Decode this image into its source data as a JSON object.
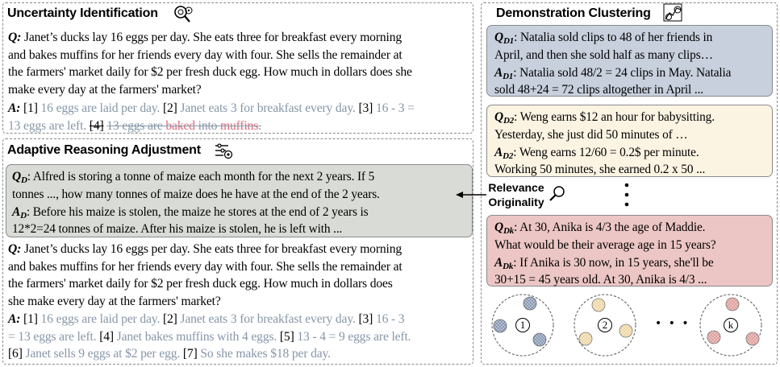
{
  "uncertainty": {
    "title": "Uncertainty Identification",
    "q_label": "Q:",
    "question_lines": [
      "Janet’s ducks lay 16 eggs per day. She eats three for breakfast every morning",
      "and bakes muffins for her friends every day with four. She sells the remainder at",
      "the farmers' market daily for $2 per fresh duck egg. How much in dollars does she",
      "make every day at the farmers' market?"
    ],
    "a_label": "A:",
    "answer": {
      "n1": "[1]",
      "s1": "16 eggs are laid per day.",
      "n2": "[2]",
      "s2": "Janet eats 3 for breakfast every day.",
      "n3": "[3]",
      "s3a": "16 - 3 =",
      "s3b": "13 eggs are left.",
      "n4": "[4]",
      "s4a": "13 eggs are ",
      "s4b": "b",
      "s4c": "aked",
      "s4d": " into ",
      "s4e": "muffins",
      "s4f": "."
    }
  },
  "adaptive": {
    "title": "Adaptive Reasoning Adjustment",
    "demo": {
      "q_label": "Q",
      "q_sub": "D",
      "a_label": "A",
      "a_sub": "D",
      "q_lines": [
        ": Alfred is storing a tonne of maize each month for the next 2 years.  If 5",
        "tonnes ..., how many tonnes of maize does he have at the end of the 2 years."
      ],
      "a_lines": [
        ": Before his maize is stolen, the maize he stores at the end of 2 years is",
        "12*2=24 tonnes of maize. After his maize is stolen, he is left with ..."
      ]
    },
    "q_label": "Q:",
    "question_lines": [
      "Janet’s ducks lay 16 eggs per day. She eats three for breakfast every morning",
      "and bakes muffins for her friends every day with four. She sells the remainder at",
      "the farmers' market daily for $2 per fresh duck egg. How much in dollars does",
      "she make every day at the farmers' market?"
    ],
    "a_label": "A:",
    "answer": {
      "n1": "[1]",
      "s1": "16 eggs are laid per day.",
      "n2": "[2]",
      "s2": "Janet eats 3 for breakfast every day.",
      "n3": "[3]",
      "s3a": "16 - 3",
      "s3b": "= 13 eggs are left.",
      "n4": "[4]",
      "s4": "Janet bakes muffins with 4 eggs.",
      "n5": "[5]",
      "s5": "13 - 4 = 9 eggs are left.",
      "n6": "[6]",
      "s6": "Janet sells 9 eggs at $2 per egg.",
      "n7": "[7]",
      "s7": "So she makes $18 per day."
    }
  },
  "clustering": {
    "title": "Demonstration Clustering",
    "relevance_label": "Relevance",
    "originality_label": "Originality",
    "boxes": [
      {
        "q_label": "Q",
        "q_sub": "D1",
        "a_label": "A",
        "a_sub": "D1",
        "q_lines": [
          ": Natalia sold clips to 48 of her friends in",
          "April, and then she sold half as many clips…"
        ],
        "a_lines": [
          ": Natalia sold 48/2 = 24 clips in May. Natalia",
          "sold 48+24 = 72 clips altogether in April ..."
        ]
      },
      {
        "q_label": "Q",
        "q_sub": "D2",
        "a_label": "A",
        "a_sub": "D2",
        "q_lines": [
          ": Weng earns $12 an hour for babysitting.",
          "Yesterday, she just did 50 minutes of …"
        ],
        "a_lines": [
          ": Weng earns 12/60 = 0.2$ per minute.",
          "Working 50 minutes, she earned 0.2 x 50 ..."
        ]
      },
      {
        "q_label": "Q",
        "q_sub": "Dk",
        "a_label": "A",
        "a_sub": "Dk",
        "q_lines": [
          ": At 30, Anika is 4/3 the age of Maddie.",
          "What would be their average age in 15 years?"
        ],
        "a_lines": [
          ": If Anika is 30 now, in 15 years, she'll be",
          "30+15 = 45 years old. At 30, Anika is 4/3 ..."
        ]
      }
    ],
    "clusters": [
      {
        "label": "1"
      },
      {
        "label": "2"
      },
      {
        "label": "k"
      }
    ],
    "ellipsis": "• • •"
  },
  "colors": {
    "box1": "#c8d0de",
    "box2": "#fcf4e3",
    "box3": "#ecc6c4",
    "demo": "#d9dcd6",
    "gray_text": "#8696a8",
    "strike_red": "#d9697a"
  }
}
